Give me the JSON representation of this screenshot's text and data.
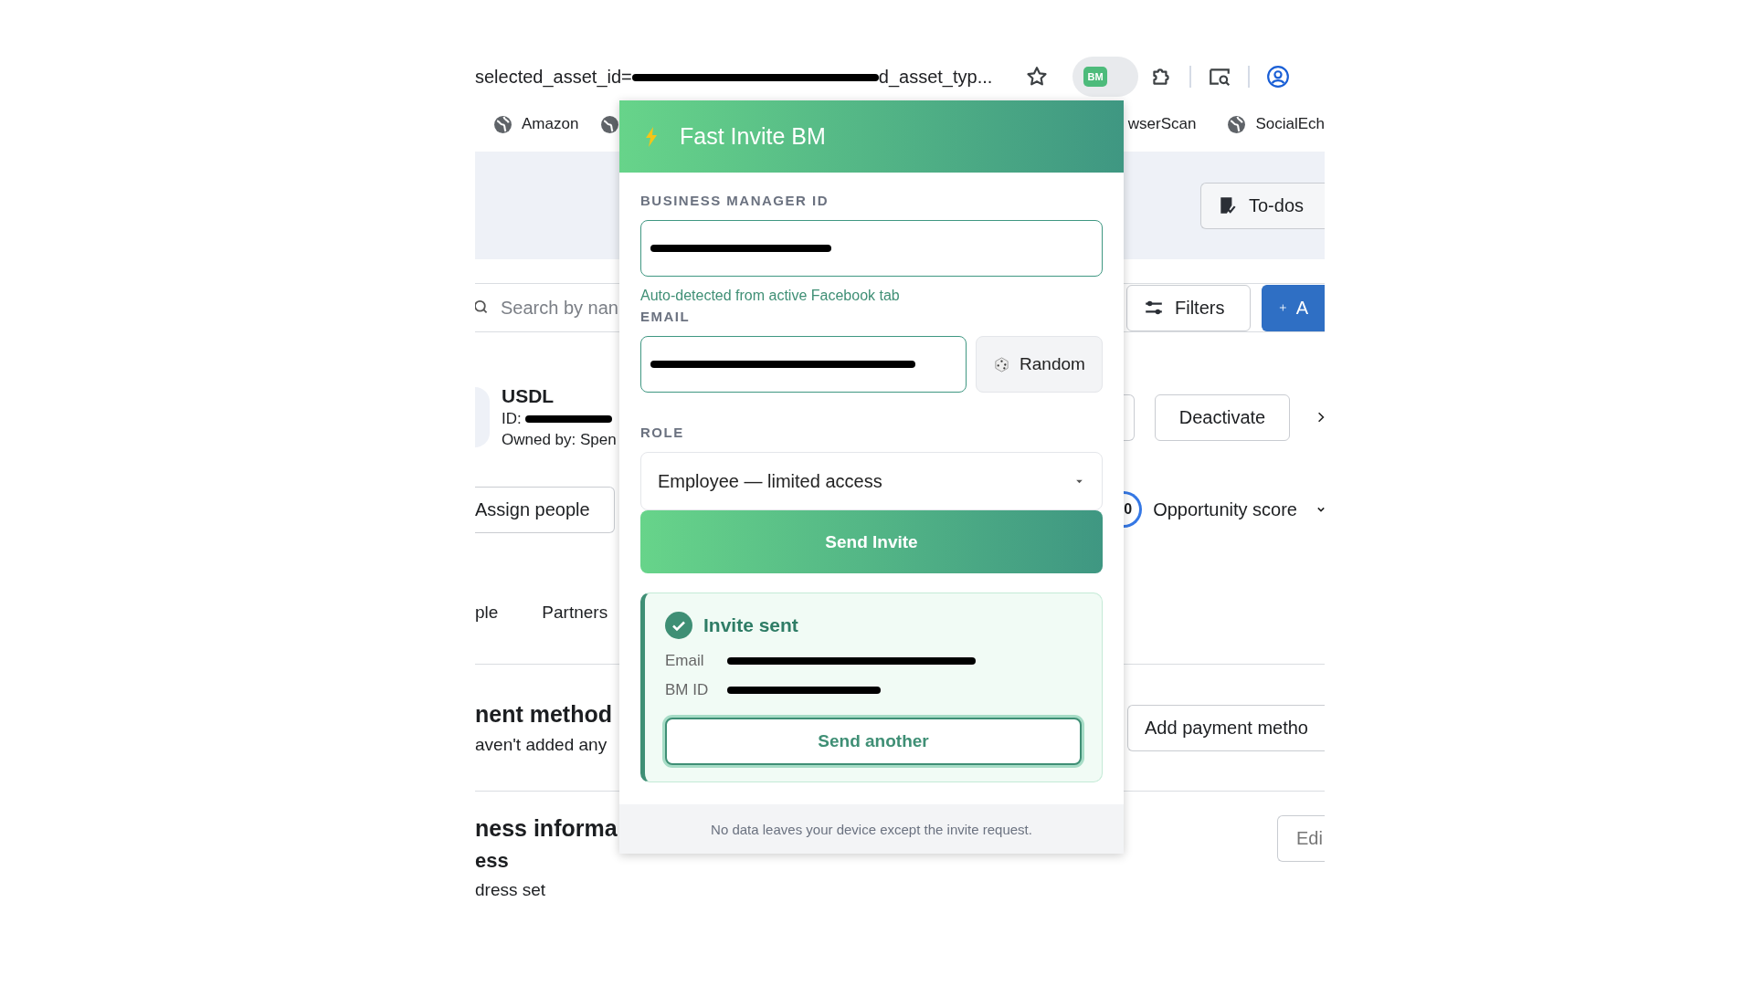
{
  "browser": {
    "url": [
      {
        "text": "selected_asset_id="
      },
      {
        "redacted": true
      },
      {
        "text": "d_asset_typ..."
      }
    ],
    "extension_badge": "BM"
  },
  "bookmarks_left": [
    {
      "label": "Amazon"
    }
  ],
  "bookmark_cut": "wserScan",
  "bookmarks_right": [
    {
      "label": "SocialEch"
    }
  ],
  "page": {
    "todos_button": "To-dos",
    "search_placeholder": "Search by nan",
    "filters_button": "Filters",
    "add_button": "A",
    "account": {
      "name": "USDL",
      "id_label": "ID:",
      "id_value": {
        "redacted": true
      },
      "owner": "Owned by: Spen"
    },
    "deactivate_button": "Deactivate",
    "assign_button": "Assign people",
    "score_value": "0",
    "score_label": "Opportunity score",
    "tabs": [
      {
        "label": "ple"
      },
      {
        "label": "Partners"
      }
    ],
    "payment": {
      "title": "nent method",
      "text": "aven't added any",
      "button": "Add payment metho"
    },
    "business": {
      "title": "ness informa",
      "subtitle": "ess",
      "text": "dress set",
      "button": "Edi"
    }
  },
  "popup": {
    "title": "Fast Invite BM",
    "bm_label": "BUSINESS MANAGER ID",
    "bm_value": {
      "redacted": true
    },
    "bm_hint": "Auto-detected from active Facebook tab",
    "email_label": "EMAIL",
    "email_value": {
      "redacted": true
    },
    "random_button": "Random",
    "role_label": "ROLE",
    "role_value": "Employee — limited access",
    "send_button": "Send Invite",
    "result": {
      "title": "Invite sent",
      "rows": [
        {
          "label": "Email",
          "value": {
            "redacted": true
          }
        },
        {
          "label": "BM ID",
          "value": {
            "redacted": true
          }
        }
      ],
      "button": "Send another"
    },
    "footer": "No data leaves your device except the invite request."
  }
}
